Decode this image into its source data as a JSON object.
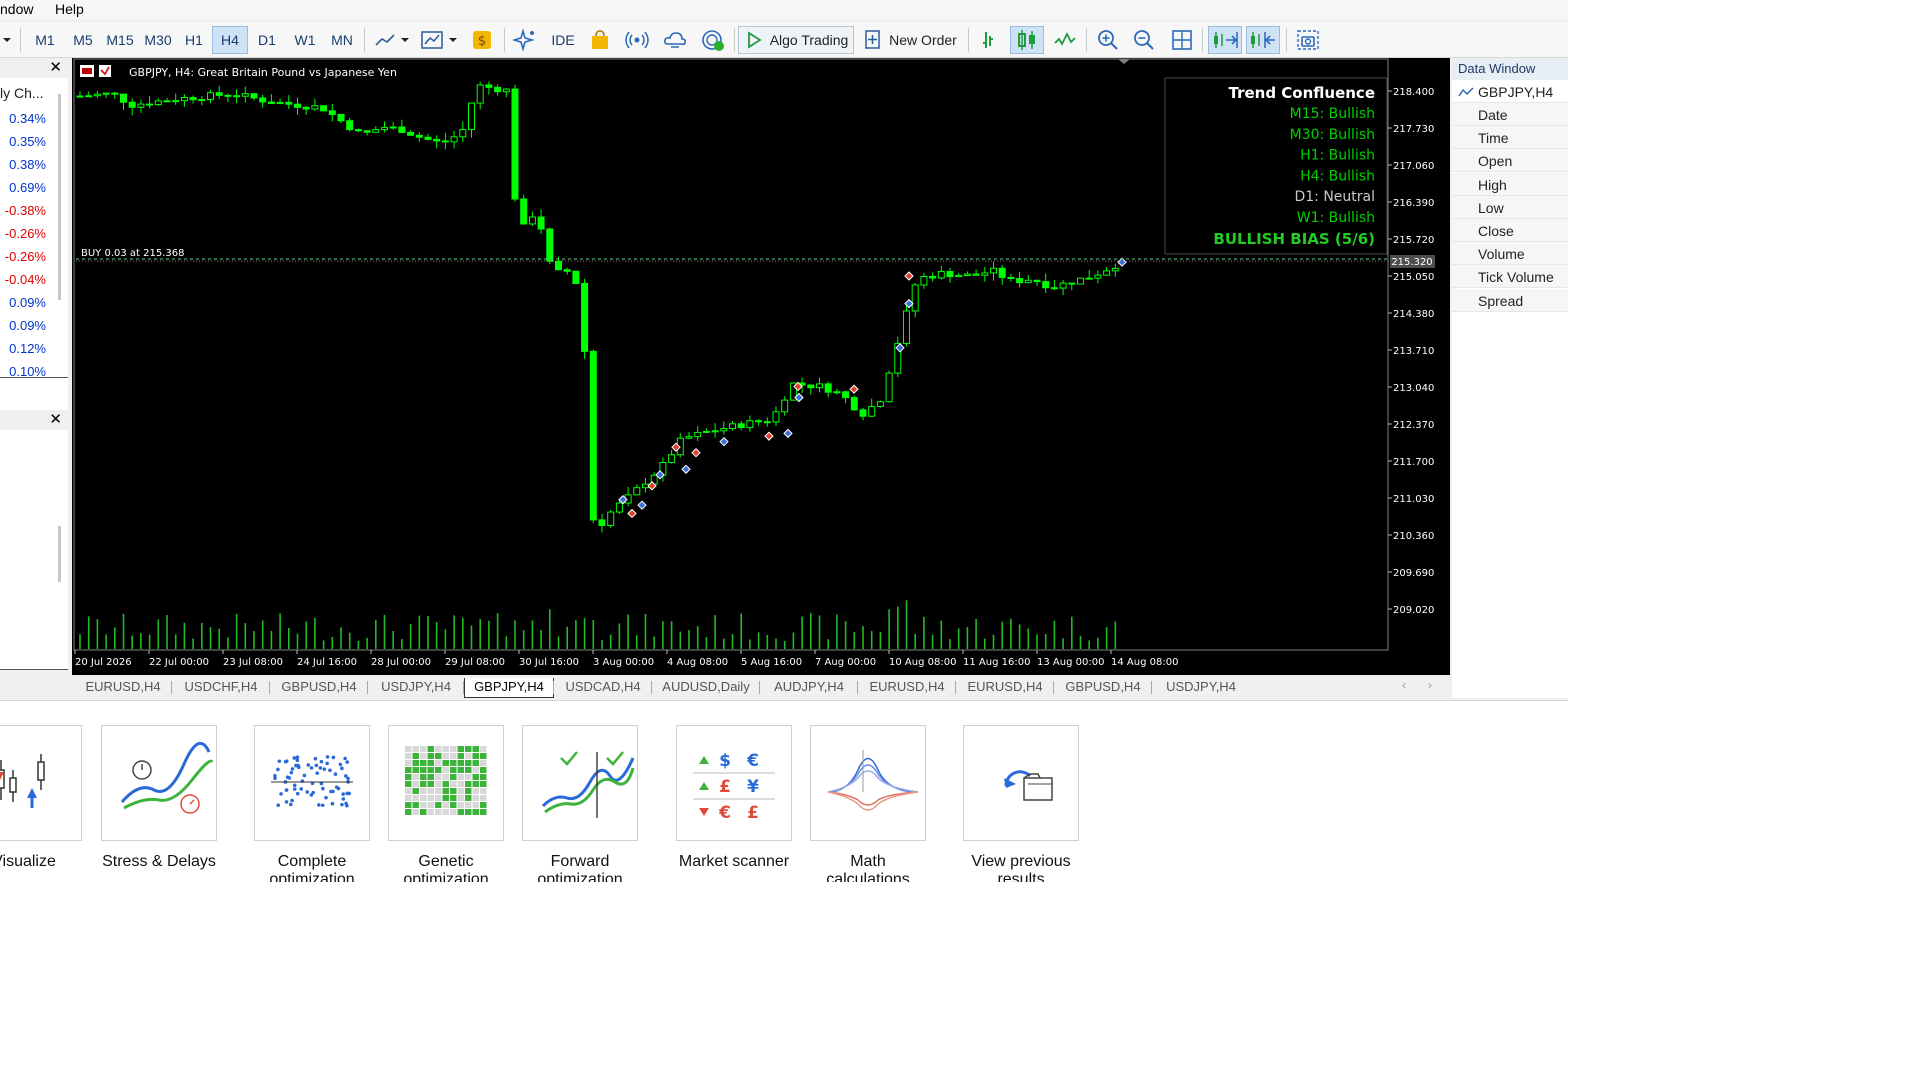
{
  "menu": {
    "window": "ndow",
    "help": "Help"
  },
  "toolbar": {
    "timeframes": [
      "M1",
      "M5",
      "M15",
      "M30",
      "H1",
      "H4",
      "D1",
      "W1",
      "MN"
    ],
    "active_timeframe": "H4",
    "ide": "IDE",
    "algo_trading": "Algo Trading",
    "new_order": "New Order"
  },
  "market_watch": {
    "header": "ly Ch...",
    "changes": [
      "0.34%",
      "0.35%",
      "0.38%",
      "0.69%",
      "-0.38%",
      "-0.26%",
      "-0.26%",
      "-0.04%",
      "0.09%",
      "0.09%",
      "0.12%",
      "0.10%"
    ],
    "colors": [
      "blue",
      "blue",
      "blue",
      "blue",
      "red",
      "red",
      "red",
      "red",
      "blue",
      "blue",
      "blue",
      "blue"
    ]
  },
  "chart": {
    "header": "GBPJPY, H4:  Great Britain Pound vs Japanese Yen",
    "order_line": "BUY 0.03 at 215.368",
    "price_tag": "215.320",
    "price_levels": [
      "218.400",
      "217.730",
      "217.060",
      "216.390",
      "215.720",
      "215.050",
      "214.380",
      "213.710",
      "213.040",
      "212.370",
      "211.700",
      "211.030",
      "210.360",
      "209.690",
      "209.020"
    ],
    "time_labels": [
      "20 Jul 2026",
      "22 Jul 00:00",
      "23 Jul 08:00",
      "24 Jul 16:00",
      "28 Jul 00:00",
      "29 Jul 08:00",
      "30 Jul 16:00",
      "3 Aug 00:00",
      "4 Aug 08:00",
      "5 Aug 16:00",
      "7 Aug 00:00",
      "10 Aug 08:00",
      "11 Aug 16:00",
      "13 Aug 00:00",
      "14 Aug 08:00"
    ],
    "colors": {
      "background": "#000000",
      "candle": "#00ff00",
      "bullish_text": "#00d000",
      "neutral_text": "#c8c8c8",
      "grid_text": "#ffffff"
    }
  },
  "confluence": {
    "title": "Trend Confluence",
    "rows": [
      {
        "tf": "M15:",
        "state": "Bullish"
      },
      {
        "tf": "M30:",
        "state": "Bullish"
      },
      {
        "tf": "H1:",
        "state": "Bullish"
      },
      {
        "tf": "H4:",
        "state": "Bullish"
      },
      {
        "tf": "D1:",
        "state": "Neutral"
      },
      {
        "tf": "W1:",
        "state": "Bullish"
      }
    ],
    "bias": "BULLISH BIAS (5/6)"
  },
  "tabs": [
    "EURUSD,H4",
    "USDCHF,H4",
    "GBPUSD,H4",
    "USDJPY,H4",
    "GBPJPY,H4",
    "USDCAD,H4",
    "AUDUSD,Daily",
    "AUDJPY,H4",
    "EURUSD,H4",
    "EURUSD,H4",
    "GBPUSD,H4",
    "USDJPY,H4"
  ],
  "active_tab": "GBPJPY,H4",
  "data_window": {
    "title": "Data Window",
    "symbol": "GBPJPY,H4",
    "fields": [
      "Date",
      "Time",
      "Open",
      "High",
      "Low",
      "Close",
      "Volume",
      "Tick Volume",
      "Spread"
    ]
  },
  "tester_cards": [
    {
      "icon": "visualize-icon",
      "label1": "Visualize",
      "label2": ""
    },
    {
      "icon": "stress-delays-icon",
      "label1": "Stress & Delays",
      "label2": ""
    },
    {
      "icon": "complete-optimization-icon",
      "label1": "Complete",
      "label2": "optimization"
    },
    {
      "icon": "genetic-optimization-icon",
      "label1": "Genetic",
      "label2": "optimization"
    },
    {
      "icon": "forward-optimization-icon",
      "label1": "Forward",
      "label2": "optimization"
    },
    {
      "icon": "market-scanner-icon",
      "label1": "Market scanner",
      "label2": ""
    },
    {
      "icon": "math-calculations-icon",
      "label1": "Math",
      "label2": "calculations"
    },
    {
      "icon": "view-previous-results-icon",
      "label1": "View previous",
      "label2": "results"
    }
  ],
  "scanner_symbols": [
    "$",
    "€",
    "£",
    "¥",
    "€",
    "£"
  ]
}
